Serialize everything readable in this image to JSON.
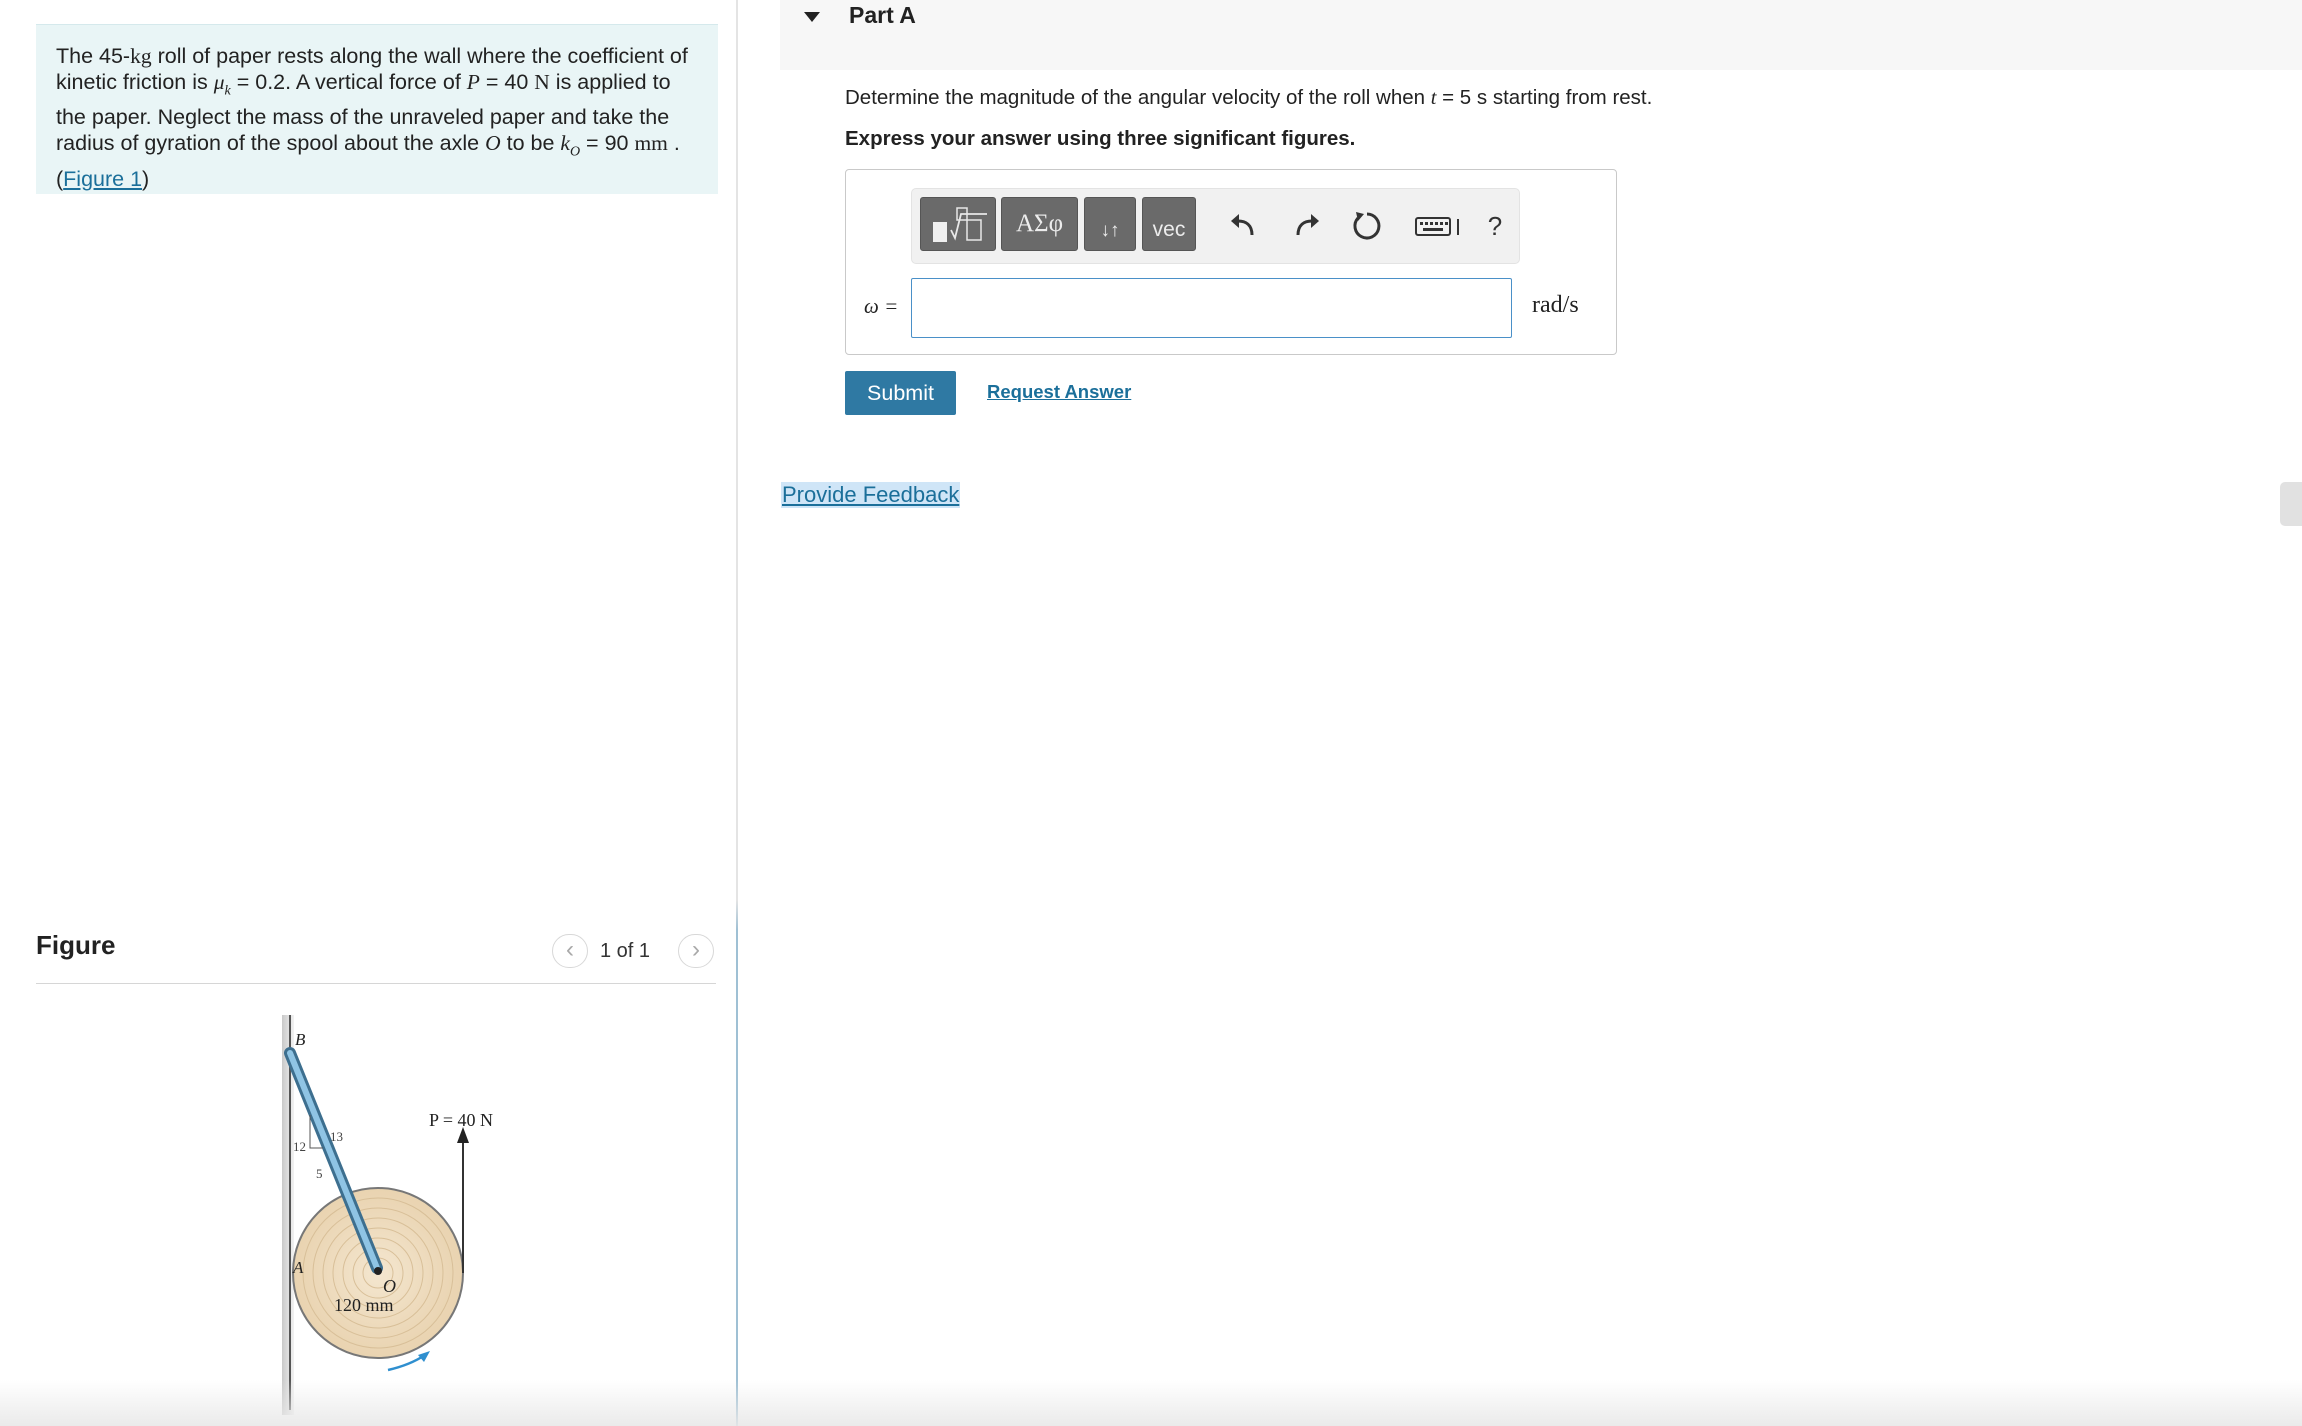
{
  "problem": {
    "text_1": "The 45-",
    "mass_unit": "kg",
    "text_2": " roll of paper rests along the wall where the coefficient of kinetic friction is ",
    "mu_symbol": "μ",
    "mu_subscript": "k",
    "text_3": " = 0.2. A vertical force of ",
    "force_symbol": "P",
    "text_4": " = 40 ",
    "force_unit": "N",
    "text_5": " is applied to the paper. Neglect the mass of the unraveled paper and take the radius of gyration of the spool about the axle ",
    "axle_symbol": "O",
    "text_6": " to be ",
    "k_symbol": "k",
    "k_subscript": "O",
    "text_7": " = 90 ",
    "length_unit": "mm",
    "text_8": " . (",
    "figure_link": "Figure 1",
    "text_9": ")"
  },
  "figure_panel": {
    "heading": "Figure",
    "counter": "1 of 1",
    "prev_icon": "chevron-left-icon",
    "next_icon": "chevron-right-icon",
    "prev_glyph": "‹",
    "next_glyph": "›"
  },
  "figure_labels": {
    "B": "B",
    "A": "A",
    "O": "O",
    "slope_12": "12",
    "slope_13": "13",
    "slope_5": "5",
    "force": "P = 40 N",
    "radius": "120 mm"
  },
  "part": {
    "title": "Part A",
    "question_1": "Determine the magnitude of the angular velocity of the roll when ",
    "time_symbol": "t",
    "question_2": " = 5  s starting from rest.",
    "instruction": "Express your answer using three significant figures."
  },
  "toolbar": {
    "templates_icon": "templates-icon",
    "greek_label": "ΑΣφ",
    "arrows_label": "↓↑",
    "vec_label": "vec",
    "undo_icon": "undo-icon",
    "redo_icon": "redo-icon",
    "reset_icon": "reset-icon",
    "keyboard_icon": "keyboard-icon",
    "help_label": "?"
  },
  "answer": {
    "variable_label": "ω =",
    "value": "",
    "unit": "rad/s"
  },
  "actions": {
    "submit": "Submit",
    "request_answer": "Request Answer",
    "feedback": "Provide Feedback"
  },
  "colors": {
    "problem_bg": "#e9f5f6",
    "link": "#1b6f9a",
    "submit_bg": "#2f79a3",
    "toolbar_button": "#6a6a6a",
    "input_border": "#4a90c8"
  }
}
